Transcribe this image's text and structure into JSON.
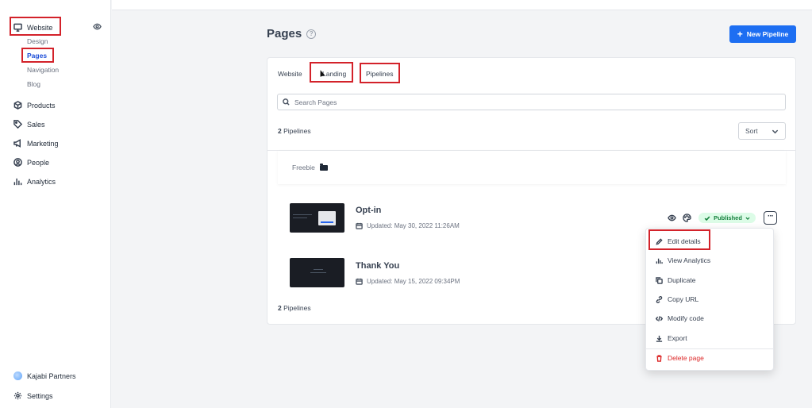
{
  "sidebar": {
    "website": "Website",
    "sub": [
      "Design",
      "Pages",
      "Navigation",
      "Blog"
    ],
    "items": [
      "Products",
      "Sales",
      "Marketing",
      "People",
      "Analytics"
    ],
    "partners": "Kajabi Partners",
    "settings": "Settings"
  },
  "header": {
    "title": "Pages",
    "help": "?",
    "new_button": "New Pipeline"
  },
  "tabs": [
    "Website",
    "Landing",
    "Pipelines"
  ],
  "search": {
    "placeholder": "Search Pages"
  },
  "count": {
    "number": "2",
    "label": "Pipelines"
  },
  "sort": "Sort",
  "folder": "Freebie",
  "pages": [
    {
      "name": "Opt-in",
      "updated": "Updated: May 30, 2022 11:26AM",
      "status": "Published"
    },
    {
      "name": "Thank You",
      "updated": "Updated: May 15, 2022 09:34PM"
    }
  ],
  "menu": [
    "Edit details",
    "View Analytics",
    "Duplicate",
    "Copy URL",
    "Modify code",
    "Export",
    "Delete page"
  ],
  "colors": {
    "primary": "#1d6ef2",
    "highlight": "#d3222a",
    "published": "#15803d",
    "danger": "#dc2626"
  }
}
